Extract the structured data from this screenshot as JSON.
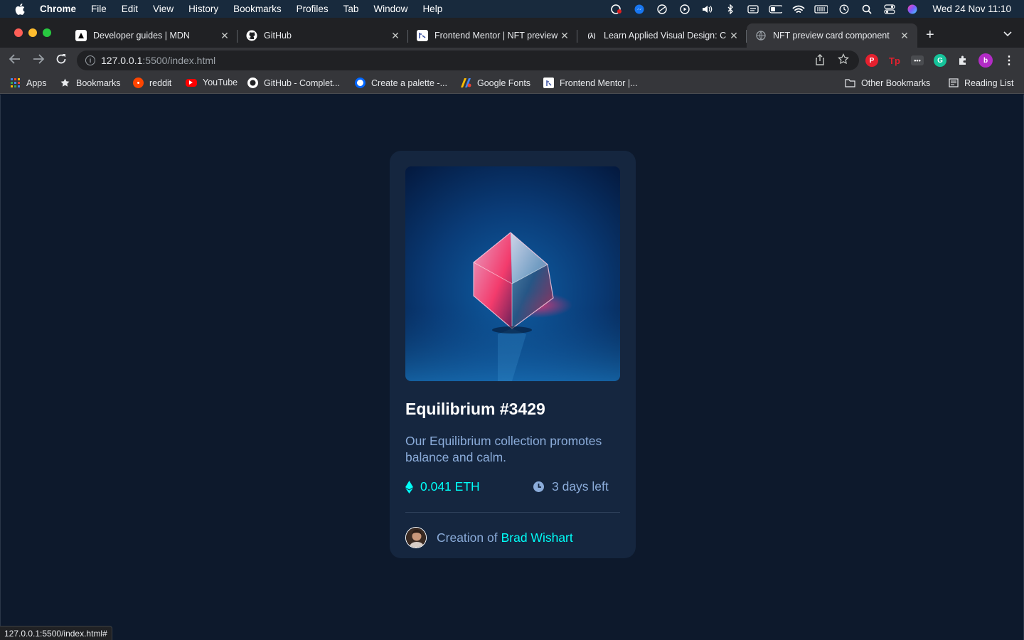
{
  "menubar": {
    "app_name": "Chrome",
    "items": [
      "File",
      "Edit",
      "View",
      "History",
      "Bookmarks",
      "Profiles",
      "Tab",
      "Window",
      "Help"
    ],
    "clock": "Wed 24 Nov  11:10"
  },
  "tabs": [
    {
      "title": "Developer guides | MDN",
      "icon": "mdn-icon"
    },
    {
      "title": "GitHub",
      "icon": "github-icon"
    },
    {
      "title": "Frontend Mentor | NFT preview",
      "icon": "frontend-mentor-icon"
    },
    {
      "title": "Learn Applied Visual Design: C",
      "icon": "freecodecamp-icon"
    },
    {
      "title": "NFT preview card component",
      "icon": "globe-icon",
      "active": true
    }
  ],
  "omnibox": {
    "host": "127.0.0.1",
    "path": ":5500/index.html"
  },
  "bookmarks": {
    "items": [
      {
        "label": "Apps",
        "icon": "apps-grid-icon"
      },
      {
        "label": "Bookmarks",
        "icon": "star-icon"
      },
      {
        "label": "reddit",
        "icon": "reddit-icon"
      },
      {
        "label": "YouTube",
        "icon": "youtube-icon"
      },
      {
        "label": "GitHub - Complet...",
        "icon": "github-icon"
      },
      {
        "label": "Create a palette -...",
        "icon": "coolors-icon"
      },
      {
        "label": "Google Fonts",
        "icon": "google-fonts-icon"
      },
      {
        "label": "Frontend Mentor |...",
        "icon": "frontend-mentor-icon"
      }
    ],
    "other": "Other Bookmarks",
    "reading_list": "Reading List"
  },
  "card": {
    "title": "Equilibrium #3429",
    "description": "Our Equilibrium collection promotes balance and calm.",
    "price": "0.041 ETH",
    "time_left": "3 days left",
    "creator_prefix": "Creation of",
    "creator_name": "Brad Wishart"
  },
  "status_url": "127.0.0.1:5500/index.html#",
  "colors": {
    "page_bg": "#0d192c",
    "card_bg": "#15263f",
    "accent_cyan": "#00fff8",
    "soft_blue": "#8bacda",
    "white": "#ffffff"
  }
}
